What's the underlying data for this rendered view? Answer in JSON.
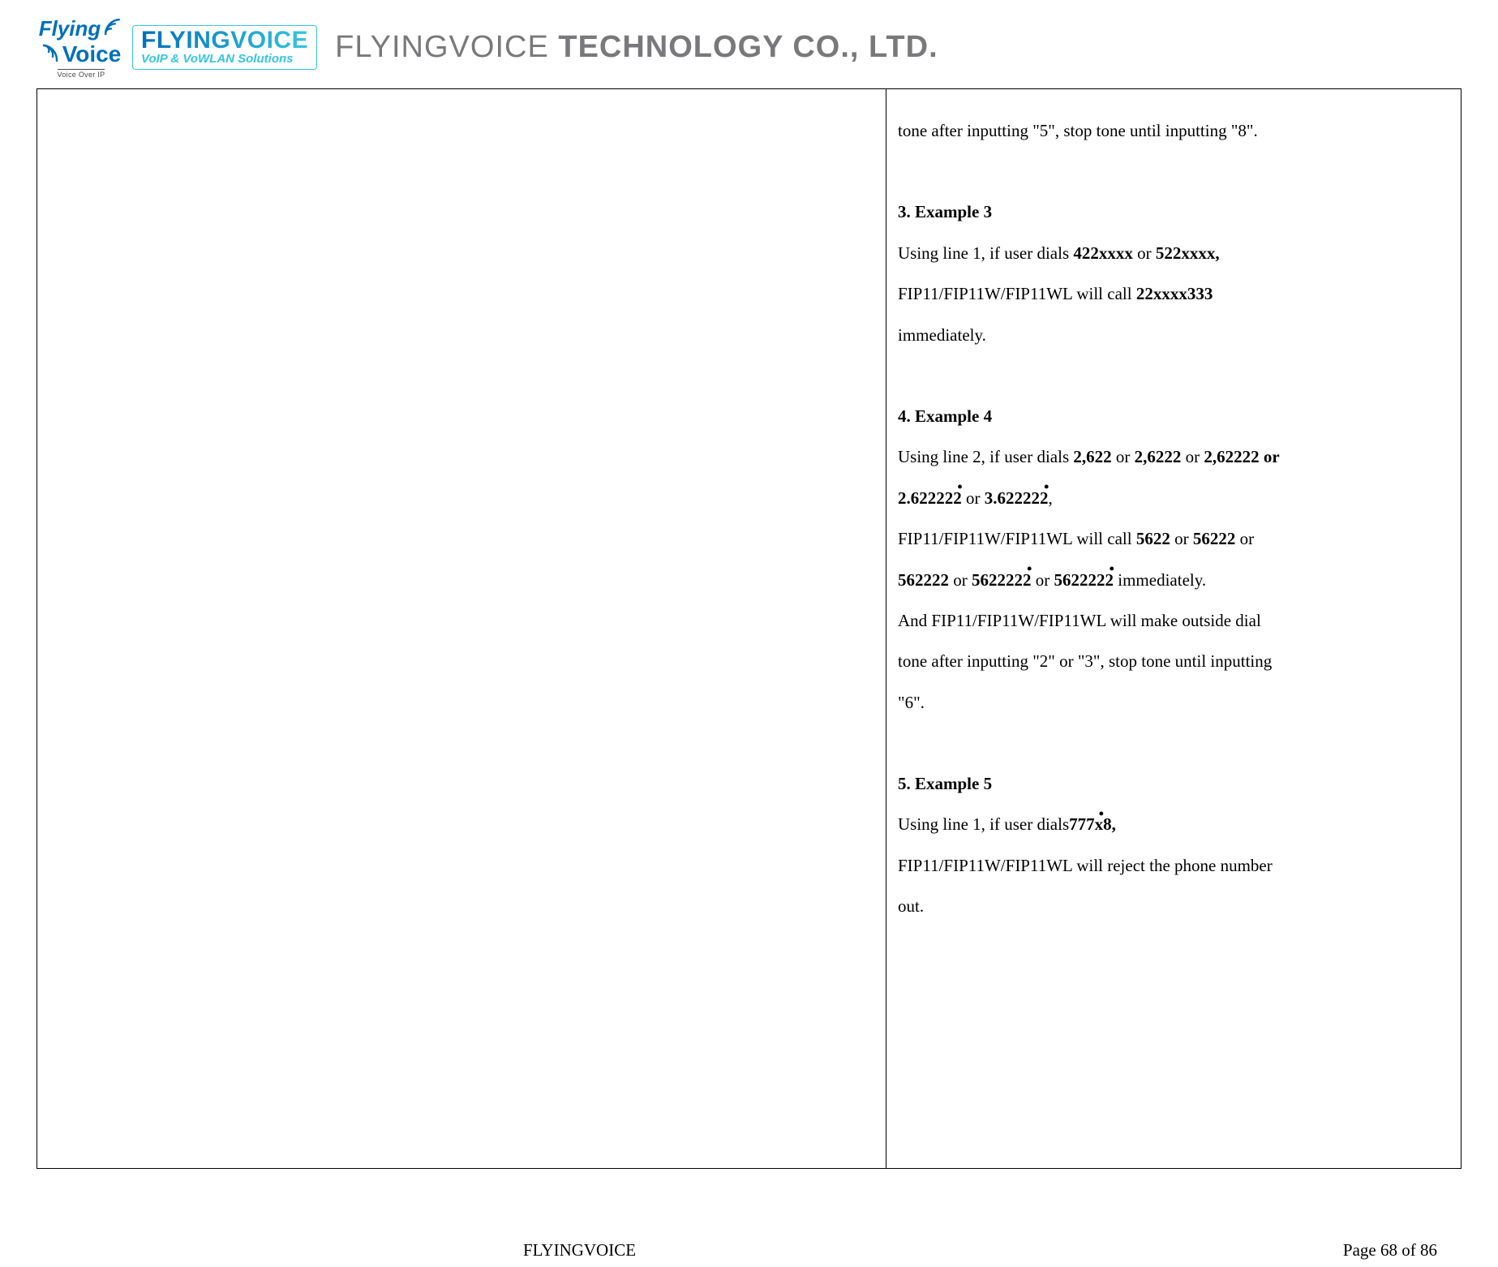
{
  "header": {
    "logo_flying": "Flying",
    "logo_voice": "Voice",
    "logo_sub": "Voice Over IP",
    "brand_name": "FLYINGVOICE",
    "brand_tag": "VoIP & VoWLAN Solutions",
    "company_thin": "FLYINGVOICE ",
    "company_bold": "TECHNOLOGY CO., LTD."
  },
  "body": {
    "line_tone": "tone after inputting \"5\", stop tone until inputting \"8\".",
    "ex3": {
      "head": "3.   Example 3",
      "p1a": "Using line 1, if user dials ",
      "p1_bold1": "422xxxx",
      "p1_or": " or ",
      "p1_bold2": "522xxxx,",
      "p2a": "FIP11/FIP11W/FIP11WL will call ",
      "p2_bold": "22xxxx333",
      "p3": "immediately."
    },
    "ex4": {
      "head": "4.   Example 4",
      "p1a": "Using line 2, if user dials ",
      "p1_b1": "2,622",
      "or": " or ",
      "p1_b2": "2,6222",
      "p1_b3": "2,62222 or",
      "p2_b1base": "2.62222",
      "p2_b1last": "2",
      "p2_or1": "  or  ",
      "p2_b2base": "3.62222",
      "p2_b2last": "2",
      "p2_comma": ",",
      "p3a": "FIP11/FIP11W/FIP11WL will call ",
      "p3_b1": "5622",
      "p3_b2": "56222",
      "p4_b1": "562222",
      "p4_or1": " or  ",
      "p4_b2base": "562222",
      "p4_b2last": "2",
      "p4_or2": "  or  ",
      "p4_b3base": "562222",
      "p4_b3last": "2",
      "p4_tail": "  immediately.",
      "p5": "And FIP11/FIP11W/FIP11WL will make outside dial",
      "p6": "tone after inputting \"2\" or \"3\", stop tone until inputting",
      "p7": "\"6\"."
    },
    "ex5": {
      "head": "5.   Example 5",
      "p1a": "Using line 1, if user dials",
      "p1_b_base": "777",
      "p1_b_dot": "x",
      "p1_b_tail": "8,",
      "p2": "FIP11/FIP11W/FIP11WL will reject the phone number",
      "p3": "out."
    }
  },
  "footer": {
    "center": "FLYINGVOICE",
    "right": "Page  68  of  86"
  }
}
